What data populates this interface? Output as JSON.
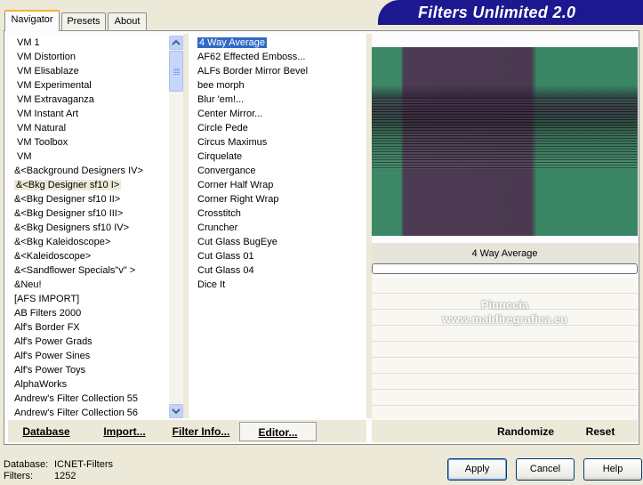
{
  "tabs": [
    {
      "label": "Navigator",
      "active": true
    },
    {
      "label": "Presets",
      "active": false
    },
    {
      "label": "About",
      "active": false
    }
  ],
  "app_title": "Filters Unlimited 2.0",
  "categories": [
    "VM 1",
    "VM Distortion",
    "VM Elisablaze",
    "VM Experimental",
    "VM Extravaganza",
    "VM Instant Art",
    "VM Natural",
    "VM Toolbox",
    "VM",
    "&<Background Designers IV>",
    "&<Bkg Designer sf10 I>",
    "&<Bkg Designer sf10 II>",
    "&<Bkg Designer sf10 III>",
    "&<Bkg Designers sf10 IV>",
    "&<Bkg Kaleidoscope>",
    "&<Kaleidoscope>",
    "&<Sandflower Specials\"v\" >",
    "&Neu!",
    "[AFS IMPORT]",
    "AB Filters 2000",
    "Alf's Border FX",
    "Alf's Power Grads",
    "Alf's Power Sines",
    "Alf's Power Toys",
    "AlphaWorks",
    "Andrew's Filter Collection 55",
    "Andrew's Filter Collection 56"
  ],
  "selected_category_index": 10,
  "filters": [
    "4 Way Average",
    "AF62 Effected Emboss...",
    "ALFs Border Mirror Bevel",
    "bee morph",
    "Blur 'em!...",
    "Center Mirror...",
    "Circle Pede",
    "Circus Maximus",
    "Cirquelate",
    "Convergance",
    "Corner Half Wrap",
    "Corner Right Wrap",
    "Crosstitch",
    "Cruncher",
    "Cut Glass  BugEye",
    "Cut Glass 01",
    "Cut Glass 04",
    "Dice It"
  ],
  "selected_filter_index": 0,
  "preview": {
    "selected_filter_name": "4 Way Average",
    "watermark_line1": "Pinuccia",
    "watermark_line2": "www.maldiregrafica.eu",
    "colors": {
      "green": "#3c8766",
      "purple": "#4a3950"
    }
  },
  "commands": {
    "database": "Database",
    "import": "Import...",
    "filter_info": "Filter Info...",
    "editor": "Editor...",
    "randomize": "Randomize",
    "reset": "Reset"
  },
  "footer": {
    "database_label": "Database:",
    "database_value": "ICNET-Filters",
    "filters_label": "Filters:",
    "filters_value": "1252"
  },
  "buttons": {
    "apply": "Apply",
    "cancel": "Cancel",
    "help": "Help"
  },
  "icons": {
    "scroll_up": "chevron-up-icon",
    "scroll_down": "chevron-down-icon"
  }
}
